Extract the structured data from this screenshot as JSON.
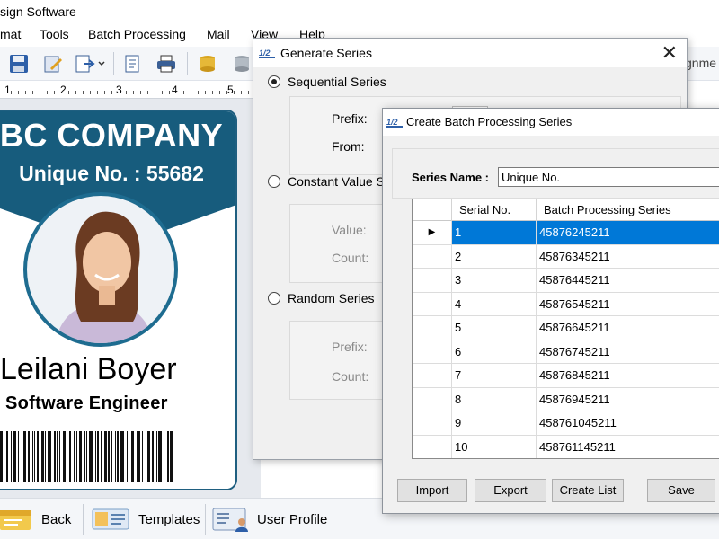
{
  "app": {
    "title": "sign Software"
  },
  "menu": [
    "mat",
    "Tools",
    "Batch Processing",
    "Mail",
    "View",
    "Help"
  ],
  "toolbar_icons": [
    "save-icon",
    "edit-icon",
    "export-icon",
    "page-icon",
    "print-icon",
    "database-icon",
    "database-icon"
  ],
  "hidden_label": "gnme",
  "ruler": {
    "numbers": [
      "1",
      "2",
      "3",
      "4",
      "5"
    ]
  },
  "card": {
    "company": "BC COMPANY",
    "unique": "Unique No. : 55682",
    "name": "Leilani Boyer",
    "title": "Software Engineer",
    "colors": {
      "band": "#175c7d"
    }
  },
  "bottom": {
    "back": "Back",
    "templates": "Templates",
    "user_profile": "User Profile"
  },
  "generate_series": {
    "title": "Generate Series",
    "sequential": {
      "label": "Sequential Series",
      "selected": true,
      "prefix_label": "Prefix:",
      "from_label": "From:"
    },
    "constant": {
      "label": "Constant Value Se",
      "selected": false,
      "value_label": "Value:",
      "count_label": "Count:"
    },
    "random": {
      "label": "Random Series",
      "selected": false,
      "prefix_label": "Prefix:",
      "count_label": "Count:"
    }
  },
  "batch": {
    "title": "Create Batch Processing Series",
    "series_name_label": "Series Name :",
    "series_name_value": "Unique No.",
    "columns": [
      "Serial No.",
      "Batch Processing Series"
    ],
    "rows": [
      [
        "1",
        "45876245211"
      ],
      [
        "2",
        "45876345211"
      ],
      [
        "3",
        "45876445211"
      ],
      [
        "4",
        "45876545211"
      ],
      [
        "5",
        "45876645211"
      ],
      [
        "6",
        "45876745211"
      ],
      [
        "7",
        "45876845211"
      ],
      [
        "8",
        "45876945211"
      ],
      [
        "9",
        "458761045211"
      ],
      [
        "10",
        "458761145211"
      ]
    ],
    "selected_row": 0,
    "row_marker": "▶",
    "buttons": {
      "import": "Import",
      "export": "Export",
      "create": "Create List",
      "save": "Save"
    }
  }
}
